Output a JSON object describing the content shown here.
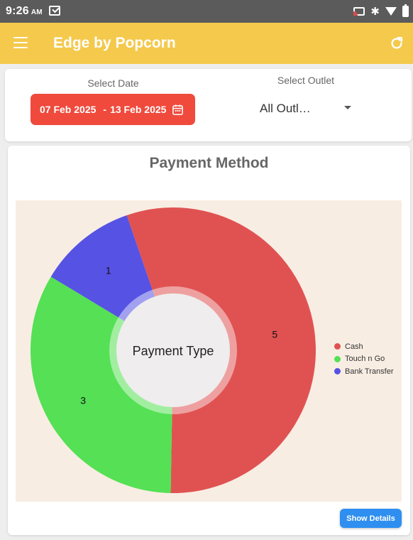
{
  "status_bar": {
    "time": "9:26",
    "period": "AM"
  },
  "app": {
    "title": "Edge by Popcorn"
  },
  "filters": {
    "date_label": "Select Date",
    "date_start": "07 Feb 2025",
    "date_end": "13 Feb 2025",
    "outlet_label": "Select Outlet",
    "outlet_value": "All Outl…"
  },
  "chart_section": {
    "title": "Payment Method",
    "center_label": "Payment Type",
    "details_button": "Show Details"
  },
  "chart_data": {
    "type": "pie",
    "categories": [
      "Cash",
      "Touch n Go",
      "Bank Transfer"
    ],
    "values": [
      5,
      3,
      1
    ],
    "colors": [
      "#e05252",
      "#55e055",
      "#5652e4"
    ],
    "legend_position": "right"
  },
  "colors": {
    "appbar": "#f4c94c",
    "date_button": "#ef4a3c",
    "details_button": "#2e8ff0",
    "plot_background": "#f8ede3"
  }
}
